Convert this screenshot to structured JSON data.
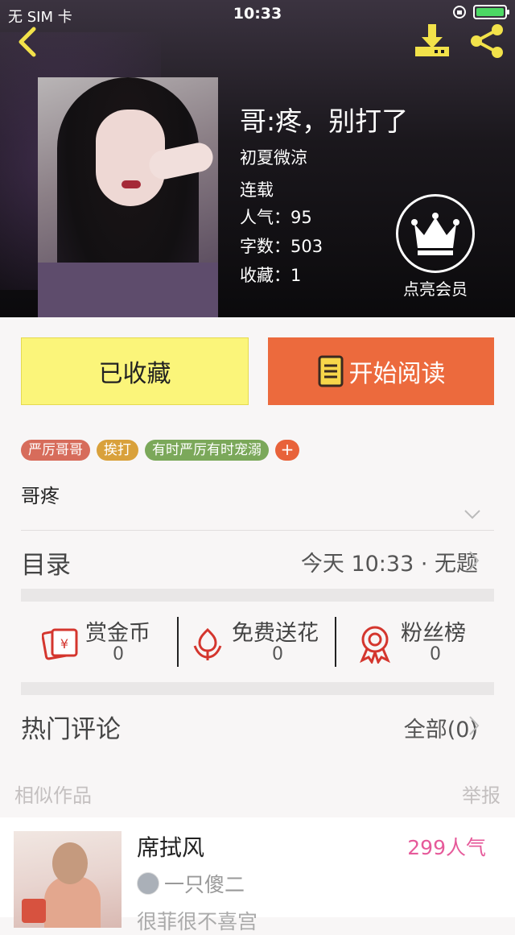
{
  "status_bar": {
    "carrier": "无 SIM 卡",
    "time": "10:33"
  },
  "book": {
    "title": "哥:疼，别打了",
    "author": "初夏微涼",
    "status": "连载",
    "popularity": "人气：95",
    "word_count": "字数：503",
    "collections": "收藏：1",
    "vip_label": "点亮会员"
  },
  "actions": {
    "favorited_label": "已收藏",
    "read_label": "开始阅读"
  },
  "tags": [
    {
      "label": "严厉哥哥",
      "color": "#d76c5b"
    },
    {
      "label": "挨打",
      "color": "#d9a13b"
    },
    {
      "label": "有时严厉有时宠溺",
      "color": "#7ba85a"
    }
  ],
  "tag_add": "+",
  "description": "哥疼",
  "catalog": {
    "label": "目录",
    "latest": "今天 10:33 · 无题"
  },
  "stats": {
    "reward": {
      "label": "赏金币",
      "value": "0"
    },
    "flower": {
      "label": "免费送花",
      "value": "0"
    },
    "fans": {
      "label": "粉丝榜",
      "value": "0"
    }
  },
  "comments": {
    "label": "热门评论",
    "all": "全部(0)"
  },
  "similar": {
    "heading": "相似作品",
    "report": "举报",
    "items": [
      {
        "title": "席拭风",
        "popularity": "299人气",
        "author": "一只傻二",
        "desc": "很菲很不喜宫"
      }
    ]
  },
  "colors": {
    "accent_orange": "#ec6a3d",
    "fav_yellow": "#fbf57a",
    "popularity_pink": "#e65a9a"
  }
}
